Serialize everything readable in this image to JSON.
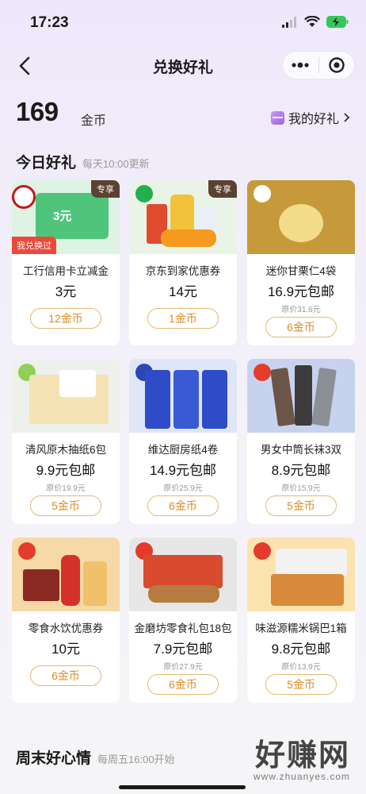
{
  "status_bar": {
    "time": "17:23"
  },
  "nav": {
    "title": "兑换好礼"
  },
  "coins": {
    "amount": "169",
    "unit": "金币",
    "my_gifts_label": "我的好礼"
  },
  "today": {
    "title": "今日好礼",
    "subtitle": "每天10:00更新"
  },
  "cards": [
    {
      "name": "工行信用卡立减金",
      "price": "3元",
      "original": "",
      "cost": "12金币",
      "tag": "专享",
      "badge": "我兑换过",
      "img_text": "3元",
      "img_bg": "#4fc57b"
    },
    {
      "name": "京东到家优惠券",
      "price": "14元",
      "original": "",
      "cost": "1金币",
      "tag": "专享",
      "badge": "",
      "img_bg": "#dff1e3"
    },
    {
      "name": "迷你甘栗仁4袋",
      "price": "16.9元包邮",
      "original": "原价31.6元",
      "cost": "6金币",
      "tag": "",
      "badge": "",
      "img_bg": "#c69a3a"
    },
    {
      "name": "清风原木抽纸6包",
      "price": "9.9元包邮",
      "original": "原价19.9元",
      "cost": "5金币",
      "tag": "",
      "badge": "",
      "img_bg": "#eef0ec"
    },
    {
      "name": "维达厨房纸4卷",
      "price": "14.9元包邮",
      "original": "原价25.9元",
      "cost": "6金币",
      "tag": "",
      "badge": "",
      "img_bg": "#3c56c8"
    },
    {
      "name": "男女中筒长袜3双",
      "price": "8.9元包邮",
      "original": "原价15.9元",
      "cost": "5金币",
      "tag": "",
      "badge": "",
      "img_bg": "#c7d3ee"
    },
    {
      "name": "零食水饮优惠券",
      "price": "10元",
      "original": "",
      "cost": "6金币",
      "tag": "",
      "badge": "",
      "img_bg": "#f6d9a6"
    },
    {
      "name": "金磨坊零食礼包18包",
      "price": "7.9元包邮",
      "original": "原价27.9元",
      "cost": "6金币",
      "tag": "",
      "badge": "",
      "img_bg": "#e7e7e7"
    },
    {
      "name": "味滋源糯米锅巴1箱",
      "price": "9.8元包邮",
      "original": "原价13.9元",
      "cost": "5金币",
      "tag": "",
      "badge": "",
      "img_bg": "#fbe3b0"
    }
  ],
  "weekend": {
    "title": "周末好心情",
    "subtitle": "每周五16:00开始"
  },
  "watermark": {
    "big": "好赚网",
    "small": "www.zhuanyes.com"
  },
  "colors": {
    "accent": "#d88e2a",
    "button_border": "#e6b873",
    "tag_dark": "#5a4231",
    "badge_red": "#e94a3a"
  }
}
